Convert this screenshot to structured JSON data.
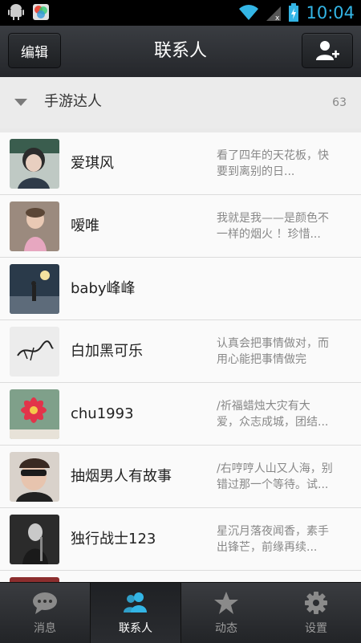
{
  "status_bar": {
    "time": "10:04",
    "icons": [
      "android-icon",
      "gallery-icon",
      "wifi-icon",
      "signal-icon",
      "battery-charging-icon"
    ]
  },
  "header": {
    "edit_label": "编辑",
    "title": "联系人",
    "add_contact_icon": "add-contact-icon"
  },
  "group": {
    "name": "手游达人",
    "count": "63"
  },
  "contacts": [
    {
      "name": "爱琪风",
      "sig1": "看了四年的天花板，快",
      "sig2": "要到离别的日..."
    },
    {
      "name": "嗳唯",
      "sig1": "我就是我——是颜色不",
      "sig2": "一样的烟火 ！珍惜..."
    },
    {
      "name": "baby峰峰",
      "sig1": "",
      "sig2": ""
    },
    {
      "name": "白加黑可乐",
      "sig1": "认真会把事情做对，而",
      "sig2": "用心能把事情做完"
    },
    {
      "name": "chu1993",
      "sig1": "/祈福蜡烛大灾有大",
      "sig2": "爱，众志成城，团结..."
    },
    {
      "name": "抽烟男人有故事",
      "sig1": "/右哼哼人山又人海，别",
      "sig2": "错过那一个等待。试..."
    },
    {
      "name": "独行战士123",
      "sig1": "星沉月落夜闻香，素手",
      "sig2": "出锋芒，前缘再续..."
    }
  ],
  "tabs": [
    {
      "label": "消息",
      "icon": "chat-bubble-icon"
    },
    {
      "label": "联系人",
      "icon": "contacts-icon"
    },
    {
      "label": "动态",
      "icon": "star-icon"
    },
    {
      "label": "设置",
      "icon": "gear-icon"
    }
  ],
  "colors": {
    "accent_blue": "#33b5e5",
    "title_bar": "#2e3135",
    "tab_active": "#ffffff",
    "tab_inactive": "#9b9b9b"
  }
}
